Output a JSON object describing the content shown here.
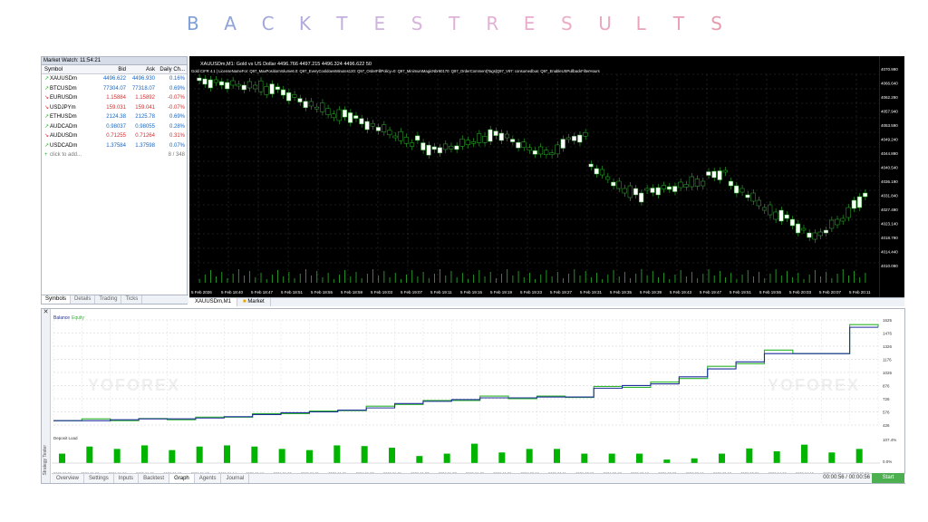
{
  "banner": {
    "letters": [
      "B",
      "A",
      "C",
      "K",
      "T",
      "E",
      "S",
      "T",
      "R",
      "E",
      "S",
      "U",
      "L",
      "T",
      "S"
    ],
    "colors": [
      "#7f9fd6",
      "#8fa3d8",
      "#a3a8da",
      "#b2acdc",
      "#c1b0de",
      "#cfb2de",
      "#d8b3dd",
      "#dfb2da",
      "#e4b0d5",
      "#e8adce",
      "#eaaac8",
      "#eaa7c2",
      "#e9a3bb",
      "#e7a0b5",
      "#e59dae"
    ]
  },
  "market_watch": {
    "title": "Market Watch: 11:54:21",
    "headers": [
      "Symbol",
      "Bid",
      "Ask",
      "Daily Ch..."
    ],
    "rows": [
      {
        "symbol": "XAUUSDm",
        "bid": "4496.622",
        "ask": "4496.930",
        "chg": "0.16%",
        "dir": "up"
      },
      {
        "symbol": "BTCUSDm",
        "bid": "77304.07",
        "ask": "77318.07",
        "chg": "0.69%",
        "dir": "up"
      },
      {
        "symbol": "EURUSDm",
        "bid": "1.15884",
        "ask": "1.15892",
        "chg": "-0.07%",
        "dir": "dn"
      },
      {
        "symbol": "USDJPYm",
        "bid": "159.031",
        "ask": "159.041",
        "chg": "-0.07%",
        "dir": "dn"
      },
      {
        "symbol": "ETHUSDm",
        "bid": "2124.38",
        "ask": "2125.78",
        "chg": "0.69%",
        "dir": "up"
      },
      {
        "symbol": "AUDCADm",
        "bid": "0.98037",
        "ask": "0.98055",
        "chg": "0.28%",
        "dir": "up"
      },
      {
        "symbol": "AUDUSDm",
        "bid": "0.71255",
        "ask": "0.71264",
        "chg": "0.31%",
        "dir": "dn"
      },
      {
        "symbol": "USDCADm",
        "bid": "1.37584",
        "ask": "1.37598",
        "chg": "0.07%",
        "dir": "up"
      }
    ],
    "add_label": "click to add...",
    "count": "8 / 348",
    "tabs": [
      "Symbols",
      "Details",
      "Trading",
      "Ticks"
    ]
  },
  "chart": {
    "header": "XAUUSDm,M1:  Gold vs US Dollar  4496.766 4497.215 4496.324 4496.622  50",
    "info_line": "Gold CIFR 4.1 | LicenseNameFor: Q97_MaxPositionVolume6.0: Q97_EveryCooldownMinutes120: Q97_OrderFillPolicy=0: Q97_MinimumMagicNbr60170: Q97_OrderComment|Tags|Q97_V97: consumedbus: Q97_EnableUSPullbackFilterHours",
    "price_ticks": [
      "4070.990",
      "4066.640",
      "4062.290",
      "4057.940",
      "4053.590",
      "4049.240",
      "4044.890",
      "4040.540",
      "4036.190",
      "4031.840",
      "4027.490",
      "4023.140",
      "4018.790",
      "4014.440",
      "4010.090"
    ],
    "time_ticks": [
      "5 Feb 2026",
      "5 Feb 18:40",
      "5 Feb 18:47",
      "5 Feb 18:51",
      "5 Feb 18:55",
      "5 Feb 18:59",
      "5 Feb 19:03",
      "5 Feb 19:07",
      "5 Feb 19:11",
      "5 Feb 19:15",
      "5 Feb 19:19",
      "5 Feb 19:23",
      "5 Feb 19:27",
      "5 Feb 19:31",
      "5 Feb 19:35",
      "5 Feb 19:39",
      "5 Feb 19:43",
      "5 Feb 19:47",
      "5 Feb 19:51",
      "5 Feb 19:55",
      "5 Feb 20:03",
      "5 Feb 20:07",
      "5 Feb 20:11"
    ],
    "tabs": [
      "XAUUSDm,M1",
      "Market"
    ]
  },
  "tester": {
    "legend_balance": "Balance",
    "legend_equity": "Equity",
    "equity_ticks": [
      "1625",
      "1476",
      "1326",
      "1176",
      "1026",
      "876",
      "726",
      "576",
      "426"
    ],
    "load_label": "Deposit Load",
    "load_ticks": [
      "107.4%",
      "0.0%"
    ],
    "dates": [
      "2026.01.01",
      "2026.01.08",
      "2026.01.09",
      "2026.01.09",
      "2026.01.12",
      "2026.01.13",
      "2026.01.14",
      "2026.01.16",
      "2026.01.20",
      "2026.01.21",
      "2026.01.21",
      "2026.01.22",
      "2026.01.26",
      "2026.01.27",
      "2026.01.27",
      "2026.01.28",
      "2026.01.30",
      "2026.02.10",
      "2026.02.11",
      "2026.02.13",
      "2026.02.17",
      "2026.02.18",
      "2026.03.02",
      "2026.03.10",
      "2026.03.18",
      "2026.03.26",
      "2026.04.08",
      "2026.04.15",
      "2026.04.28",
      "2026.05.08"
    ],
    "tabs": [
      "Overview",
      "Settings",
      "Inputs",
      "Backtest",
      "Graph",
      "Agents",
      "Journal"
    ],
    "active_tab": "Graph",
    "time": "00:00:56 / 00:00:56",
    "start": "Start",
    "side_label": "Strategy Tester",
    "watermark": "YOFOREX",
    "balance_color": "#1f2f9a",
    "equity_color": "#2db52d"
  },
  "chart_data": [
    {
      "type": "line",
      "title": "",
      "series": [
        {
          "name": "Balance",
          "x": [
            0,
            1,
            2,
            3,
            4,
            5,
            6,
            7,
            8,
            9,
            10,
            11,
            12,
            13,
            14,
            15,
            16,
            17,
            18,
            19,
            20,
            21,
            22,
            23,
            24,
            25,
            26,
            27,
            28,
            29
          ],
          "values": [
            476,
            476,
            486,
            496,
            496,
            506,
            521,
            546,
            566,
            576,
            596,
            621,
            671,
            696,
            716,
            736,
            736,
            746,
            746,
            846,
            876,
            896,
            976,
            1066,
            1146,
            1241,
            1241,
            1241,
            1541,
            1541
          ]
        },
        {
          "name": "Equity",
          "x": [
            0,
            1,
            2,
            3,
            4,
            5,
            6,
            7,
            8,
            9,
            10,
            11,
            12,
            13,
            14,
            15,
            16,
            17,
            18,
            19,
            20,
            21,
            22,
            23,
            24,
            25,
            26,
            27,
            28,
            29
          ],
          "values": [
            476,
            496,
            476,
            501,
            486,
            516,
            516,
            556,
            556,
            586,
            591,
            641,
            661,
            706,
            706,
            756,
            726,
            756,
            741,
            866,
            856,
            916,
            956,
            1096,
            1126,
            1281,
            1241,
            1241,
            1571,
            1541
          ]
        }
      ],
      "ylim": [
        426,
        1625
      ]
    },
    {
      "type": "bar",
      "title": "Deposit Load",
      "values": [
        40,
        70,
        60,
        75,
        55,
        70,
        75,
        70,
        60,
        55,
        75,
        72,
        65,
        30,
        40,
        82,
        45,
        60,
        60,
        40,
        40,
        40,
        15,
        20,
        40,
        62,
        50,
        78,
        45,
        60
      ],
      "ylim": [
        0,
        107.4
      ]
    }
  ]
}
